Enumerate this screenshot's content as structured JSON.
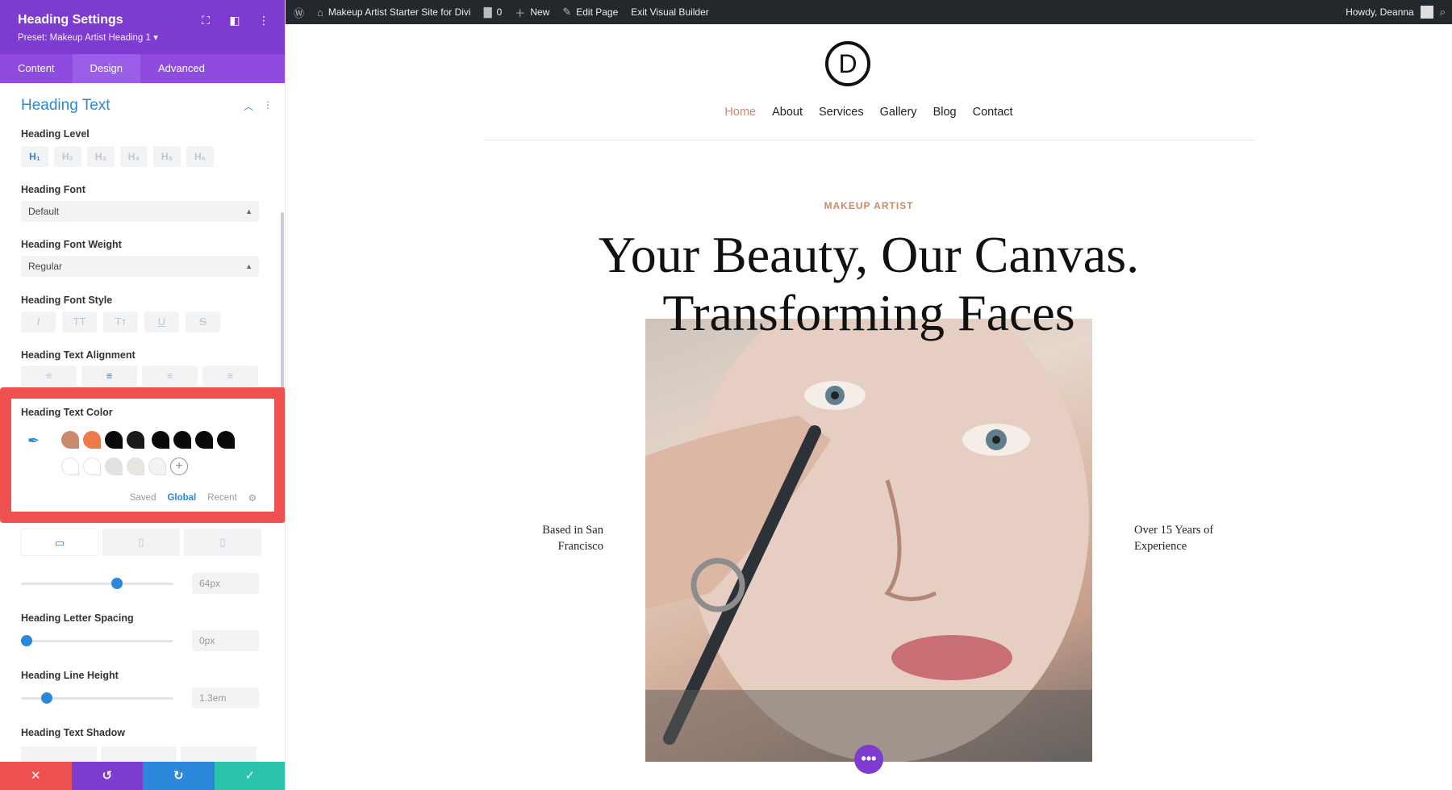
{
  "panel": {
    "title": "Heading Settings",
    "preset": "Preset: Makeup Artist Heading 1 ▾",
    "tabs": [
      "Content",
      "Design",
      "Advanced"
    ],
    "section": "Heading Text",
    "heading_level_label": "Heading Level",
    "heading_levels": [
      "H₁",
      "H₂",
      "H₃",
      "H₄",
      "H₅",
      "H₆"
    ],
    "font_label": "Heading Font",
    "font_value": "Default",
    "weight_label": "Heading Font Weight",
    "weight_value": "Regular",
    "style_label": "Heading Font Style",
    "styles": [
      "I",
      "TT",
      "Tт",
      "U",
      "S"
    ],
    "align_label": "Heading Text Alignment",
    "color_label": "Heading Text Color",
    "swatches_row1": [
      "#c98a6e",
      "#ee7a4a",
      "#0a0a0a",
      "#1a1a1a",
      "#0a0a0a",
      "#0a0a0a",
      "#0a0a0a",
      "#0a0a0a"
    ],
    "swatches_row2": [
      "#ffffff",
      "#ffffff",
      "#e4e2df",
      "#e9e5e1",
      "#f4f3f2"
    ],
    "color_tabs": [
      "Saved",
      "Global",
      "Recent"
    ],
    "size_value": "64px",
    "letter_spacing_label": "Heading Letter Spacing",
    "letter_spacing_value": "0px",
    "line_height_label": "Heading Line Height",
    "line_height_value": "1.3em",
    "shadow_label": "Heading Text Shadow",
    "footer_colors": [
      "#ef5050",
      "#7e3bd0",
      "#2b87da",
      "#29c4a9"
    ]
  },
  "adminbar": {
    "site_name": "Makeup Artist Starter Site for Divi",
    "comments": "0",
    "new": "New",
    "edit": "Edit Page",
    "exit": "Exit Visual Builder",
    "howdy": "Howdy, Deanna"
  },
  "site": {
    "logo": "D",
    "nav": [
      "Home",
      "About",
      "Services",
      "Gallery",
      "Blog",
      "Contact"
    ],
    "eyebrow": "MAKEUP ARTIST",
    "headline_1": "Your Beauty, Our Canvas.",
    "headline_2": "Transforming Faces",
    "side_left": "Based in San Francisco",
    "side_right": "Over 15 Years of Experience"
  }
}
